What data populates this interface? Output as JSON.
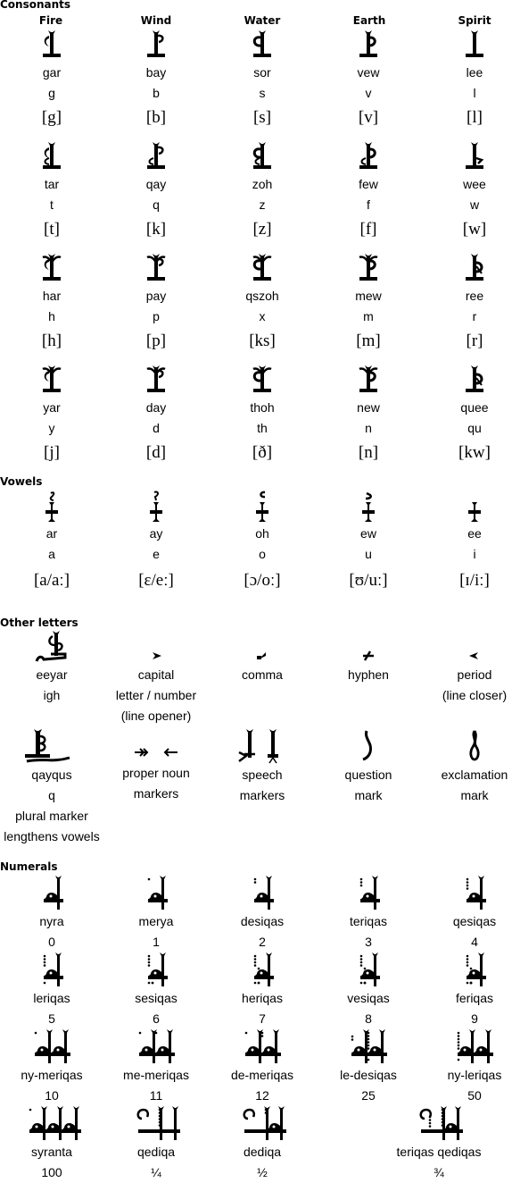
{
  "sections": {
    "consonants": {
      "title": "Consonants",
      "columns": [
        "Fire",
        "Wind",
        "Water",
        "Earth",
        "Spirit"
      ],
      "rows": [
        [
          {
            "glyph": "fire-g-glyph",
            "name": "gar",
            "latin": "g",
            "ipa": "[g]"
          },
          {
            "glyph": "wind-b-glyph",
            "name": "bay",
            "latin": "b",
            "ipa": "[b]"
          },
          {
            "glyph": "water-s-glyph",
            "name": "sor",
            "latin": "s",
            "ipa": "[s]"
          },
          {
            "glyph": "earth-v-glyph",
            "name": "vew",
            "latin": "v",
            "ipa": "[v]"
          },
          {
            "glyph": "spirit-l-glyph",
            "name": "lee",
            "latin": "l",
            "ipa": "[l]"
          }
        ],
        [
          {
            "glyph": "fire-t-glyph",
            "name": "tar",
            "latin": "t",
            "ipa": "[t]"
          },
          {
            "glyph": "wind-q-glyph",
            "name": "qay",
            "latin": "q",
            "ipa": "[k]"
          },
          {
            "glyph": "water-z-glyph",
            "name": "zoh",
            "latin": "z",
            "ipa": "[z]"
          },
          {
            "glyph": "earth-f-glyph",
            "name": "few",
            "latin": "f",
            "ipa": "[f]"
          },
          {
            "glyph": "spirit-w-glyph",
            "name": "wee",
            "latin": "w",
            "ipa": "[w]"
          }
        ],
        [
          {
            "glyph": "fire-h-glyph",
            "name": "har",
            "latin": "h",
            "ipa": "[h]"
          },
          {
            "glyph": "wind-p-glyph",
            "name": "pay",
            "latin": "p",
            "ipa": "[p]"
          },
          {
            "glyph": "water-x-glyph",
            "name": "qszoh",
            "latin": "x",
            "ipa": "[ks]"
          },
          {
            "glyph": "earth-m-glyph",
            "name": "mew",
            "latin": "m",
            "ipa": "[m]"
          },
          {
            "glyph": "spirit-r-glyph",
            "name": "ree",
            "latin": "r",
            "ipa": "[r]"
          }
        ],
        [
          {
            "glyph": "fire-y-glyph",
            "name": "yar",
            "latin": "y",
            "ipa": "[j]"
          },
          {
            "glyph": "wind-d-glyph",
            "name": "day",
            "latin": "d",
            "ipa": "[d]"
          },
          {
            "glyph": "water-th-glyph",
            "name": "thoh",
            "latin": "th",
            "ipa": "[ð]"
          },
          {
            "glyph": "earth-n-glyph",
            "name": "new",
            "latin": "n",
            "ipa": "[n]"
          },
          {
            "glyph": "spirit-qu-glyph",
            "name": "quee",
            "latin": "qu",
            "ipa": "[kw]"
          }
        ]
      ]
    },
    "vowels": {
      "title": "Vowels",
      "items": [
        {
          "glyph": "vowel-a-glyph",
          "name": "ar",
          "latin": "a",
          "ipa": "[a/aː]"
        },
        {
          "glyph": "vowel-e-glyph",
          "name": "ay",
          "latin": "e",
          "ipa": "[ɛ/eː]"
        },
        {
          "glyph": "vowel-o-glyph",
          "name": "oh",
          "latin": "o",
          "ipa": "[ɔ/oː]"
        },
        {
          "glyph": "vowel-u-glyph",
          "name": "ew",
          "latin": "u",
          "ipa": "[ʊ/uː]"
        },
        {
          "glyph": "vowel-i-glyph",
          "name": "ee",
          "latin": "i",
          "ipa": "[ɪ/iː]"
        }
      ]
    },
    "other": {
      "title": "Other letters",
      "rows": [
        [
          {
            "glyph": "eeyar-glyph",
            "lines": [
              "eeyar",
              "igh"
            ]
          },
          {
            "glyph": "capital-marker-glyph",
            "lines": [
              "capital",
              "letter / number",
              "(line opener)"
            ]
          },
          {
            "glyph": "comma-glyph",
            "lines": [
              "comma"
            ]
          },
          {
            "glyph": "hyphen-glyph",
            "lines": [
              "hyphen"
            ]
          },
          {
            "glyph": "period-glyph",
            "lines": [
              "period",
              "(line closer)"
            ]
          }
        ],
        [
          {
            "glyph": "qayqus-glyph",
            "lines": [
              "qayqus",
              "q",
              "plural marker",
              "lengthens vowels"
            ]
          },
          {
            "glyph": "proper-noun-markers-glyph",
            "lines": [
              "proper noun",
              "markers"
            ]
          },
          {
            "glyph": "speech-markers-glyph",
            "lines": [
              "speech",
              "markers"
            ]
          },
          {
            "glyph": "question-mark-glyph",
            "lines": [
              "question",
              "mark"
            ]
          },
          {
            "glyph": "exclamation-mark-glyph",
            "lines": [
              "exclamation",
              "mark"
            ]
          }
        ]
      ]
    },
    "numerals": {
      "title": "Numerals",
      "rows": [
        [
          {
            "name": "nyra",
            "value": "0"
          },
          {
            "name": "merya",
            "value": "1"
          },
          {
            "name": "desiqas",
            "value": "2"
          },
          {
            "name": "teriqas",
            "value": "3"
          },
          {
            "name": "qesiqas",
            "value": "4"
          }
        ],
        [
          {
            "name": "leriqas",
            "value": "5"
          },
          {
            "name": "sesiqas",
            "value": "6"
          },
          {
            "name": "heriqas",
            "value": "7"
          },
          {
            "name": "vesiqas",
            "value": "8"
          },
          {
            "name": "feriqas",
            "value": "9"
          }
        ],
        [
          {
            "name": "ny-meriqas",
            "value": "10"
          },
          {
            "name": "me-meriqas",
            "value": "11"
          },
          {
            "name": "de-meriqas",
            "value": "12"
          },
          {
            "name": "le-desiqas",
            "value": "25"
          },
          {
            "name": "ny-leriqas",
            "value": "50"
          }
        ],
        [
          {
            "name": "syranta",
            "value": "100"
          },
          {
            "name": "qediqa",
            "value": "¼"
          },
          {
            "name": "dediqa",
            "value": "½"
          },
          {
            "name": "teriqas qediqas",
            "value": "¾"
          }
        ]
      ]
    }
  }
}
